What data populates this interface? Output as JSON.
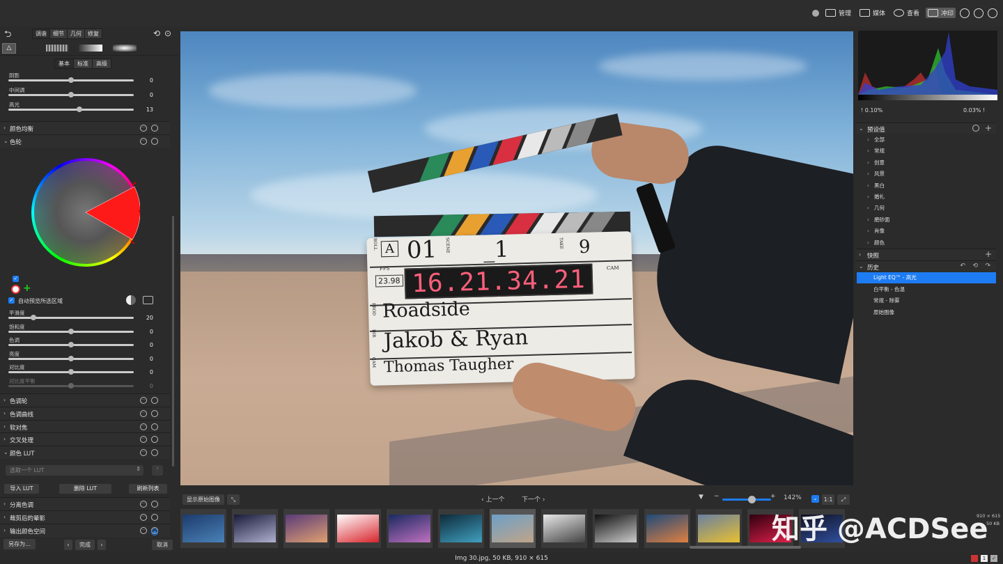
{
  "modes": [
    {
      "label": "管理",
      "icon": "grid-icon"
    },
    {
      "label": "媒体",
      "icon": "media-icon"
    },
    {
      "label": "查看",
      "icon": "eye-icon"
    },
    {
      "label": "冲印",
      "icon": "develop-icon",
      "active": true
    }
  ],
  "left": {
    "tabs": [
      "调谐",
      "细节",
      "几何",
      "修复"
    ],
    "subtabs": [
      "基本",
      "标准",
      "高级"
    ],
    "tone_sliders": [
      {
        "label": "阴影",
        "value": "0",
        "pos": 0.5
      },
      {
        "label": "中间调",
        "value": "0",
        "pos": 0.5
      },
      {
        "label": "高光",
        "value": "13",
        "pos": 0.565
      }
    ],
    "sections_top": [
      {
        "label": "颜色均衡",
        "expanded": false
      },
      {
        "label": "色轮",
        "expanded": true
      }
    ],
    "auto_preview_label": "自动预览所选区域",
    "wheel_sliders": [
      {
        "label": "平滑度",
        "value": "20",
        "pos": 0.2
      },
      {
        "label": "饱和度",
        "value": "0",
        "pos": 0.5
      },
      {
        "label": "色调",
        "value": "0",
        "pos": 0.5
      },
      {
        "label": "亮度",
        "value": "0",
        "pos": 0.5
      },
      {
        "label": "对比度",
        "value": "0",
        "pos": 0.5
      },
      {
        "label": "对比度平衡",
        "value": "0",
        "pos": 0.5,
        "disabled": true
      }
    ],
    "sections_mid": [
      {
        "label": "色调轮"
      },
      {
        "label": "色调曲线"
      },
      {
        "label": "软对焦"
      },
      {
        "label": "交叉处理"
      },
      {
        "label": "颜色 LUT",
        "expanded": true
      }
    ],
    "lut_placeholder": "选取一个 LUT",
    "lut_buttons": [
      "导入 LUT",
      "删除 LUT",
      "刷新列表"
    ],
    "sections_bottom": [
      {
        "label": "分离色调"
      },
      {
        "label": "裁剪后的晕影"
      },
      {
        "label": "输出颜色空间"
      }
    ],
    "save_as": "另存为...",
    "done": "完成",
    "cancel": "取消"
  },
  "clapper": {
    "roll": "A",
    "scene": "01",
    "take_mark": "_1",
    "take": "9",
    "fps_label": "FPS",
    "fps": "23.98",
    "timecode": "16.21.34.21",
    "cam_label": "CAM",
    "title": "Roadside",
    "director": "Jakob & Ryan",
    "cam": "Thomas Taugher",
    "row_labels": [
      "PROD",
      "DIR",
      "CAM"
    ],
    "head_labels": [
      "ROLL",
      "SCENE",
      "TAKE"
    ]
  },
  "viewer_toolbar": {
    "show_original": "显示原始图像",
    "prev": "上一个",
    "next": "下一个",
    "zoom": "142%",
    "one_to_one": "1:1",
    "zoom_level": 0.6
  },
  "filmstrip": [
    {
      "name": "thumb-1",
      "colors": [
        "#1d3b6b",
        "#4a82b8"
      ]
    },
    {
      "name": "thumb-2",
      "colors": [
        "#1a1a3a",
        "#b0b0d0"
      ]
    },
    {
      "name": "thumb-3",
      "colors": [
        "#5a3b7a",
        "#e0a070"
      ]
    },
    {
      "name": "thumb-4",
      "colors": [
        "#ffffff",
        "#d8242c"
      ]
    },
    {
      "name": "thumb-5",
      "colors": [
        "#1a2a60",
        "#c070c0"
      ]
    },
    {
      "name": "thumb-6",
      "colors": [
        "#0e2a3a",
        "#40a0c0"
      ]
    },
    {
      "name": "thumb-7",
      "colors": [
        "#6da0c8",
        "#c0a488"
      ],
      "selected": true
    },
    {
      "name": "thumb-8",
      "colors": [
        "#e8e8e8",
        "#444444"
      ]
    },
    {
      "name": "thumb-9",
      "colors": [
        "#111111",
        "#cccccc"
      ]
    },
    {
      "name": "thumb-10",
      "colors": [
        "#1f4a7a",
        "#e08040"
      ]
    },
    {
      "name": "thumb-11",
      "colors": [
        "#6a80a0",
        "#e8c030"
      ]
    },
    {
      "name": "thumb-12",
      "colors": [
        "#300010",
        "#e0204a"
      ]
    },
    {
      "name": "thumb-13",
      "colors": [
        "#101020",
        "#3050a0"
      ]
    }
  ],
  "right": {
    "clip_low": "0.10%",
    "clip_high": "0.03%",
    "presets_title": "预设值",
    "presets": [
      "全部",
      "常规",
      "创意",
      "风景",
      "黑白",
      "婚礼",
      "几何",
      "磨砂面",
      "肖像",
      "颜色"
    ],
    "snapshots_title": "快照",
    "history_title": "历史",
    "history": [
      {
        "label": "Light EQ™ - 高光",
        "selected": true
      },
      {
        "label": "白平衡 - 色温"
      },
      {
        "label": "常规 - 除雾"
      },
      {
        "label": "原始图像"
      }
    ],
    "mini_size": "910 × 615",
    "mini_kb": "50 KB"
  },
  "status": "Img 30.jpg, 50 KB, 910 × 615",
  "watermark": "知乎 @ACDSee",
  "colors": {
    "accent": "#1d7cf2",
    "panel": "#2b2b2b"
  }
}
